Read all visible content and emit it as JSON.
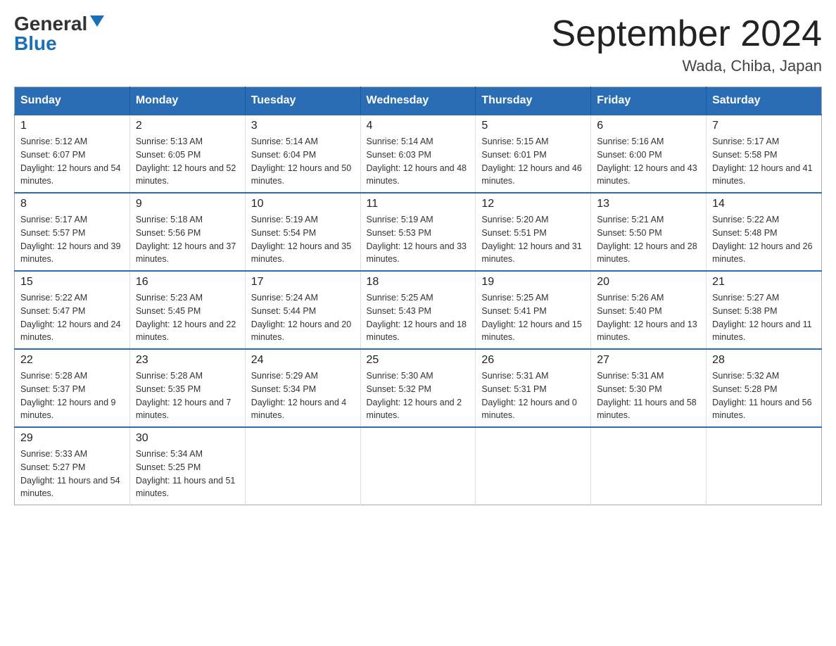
{
  "logo": {
    "general": "General",
    "blue": "Blue"
  },
  "header": {
    "title": "September 2024",
    "location": "Wada, Chiba, Japan"
  },
  "calendar": {
    "days_of_week": [
      "Sunday",
      "Monday",
      "Tuesday",
      "Wednesday",
      "Thursday",
      "Friday",
      "Saturday"
    ],
    "weeks": [
      [
        {
          "day": "1",
          "sunrise": "5:12 AM",
          "sunset": "6:07 PM",
          "daylight": "12 hours and 54 minutes."
        },
        {
          "day": "2",
          "sunrise": "5:13 AM",
          "sunset": "6:05 PM",
          "daylight": "12 hours and 52 minutes."
        },
        {
          "day": "3",
          "sunrise": "5:14 AM",
          "sunset": "6:04 PM",
          "daylight": "12 hours and 50 minutes."
        },
        {
          "day": "4",
          "sunrise": "5:14 AM",
          "sunset": "6:03 PM",
          "daylight": "12 hours and 48 minutes."
        },
        {
          "day": "5",
          "sunrise": "5:15 AM",
          "sunset": "6:01 PM",
          "daylight": "12 hours and 46 minutes."
        },
        {
          "day": "6",
          "sunrise": "5:16 AM",
          "sunset": "6:00 PM",
          "daylight": "12 hours and 43 minutes."
        },
        {
          "day": "7",
          "sunrise": "5:17 AM",
          "sunset": "5:58 PM",
          "daylight": "12 hours and 41 minutes."
        }
      ],
      [
        {
          "day": "8",
          "sunrise": "5:17 AM",
          "sunset": "5:57 PM",
          "daylight": "12 hours and 39 minutes."
        },
        {
          "day": "9",
          "sunrise": "5:18 AM",
          "sunset": "5:56 PM",
          "daylight": "12 hours and 37 minutes."
        },
        {
          "day": "10",
          "sunrise": "5:19 AM",
          "sunset": "5:54 PM",
          "daylight": "12 hours and 35 minutes."
        },
        {
          "day": "11",
          "sunrise": "5:19 AM",
          "sunset": "5:53 PM",
          "daylight": "12 hours and 33 minutes."
        },
        {
          "day": "12",
          "sunrise": "5:20 AM",
          "sunset": "5:51 PM",
          "daylight": "12 hours and 31 minutes."
        },
        {
          "day": "13",
          "sunrise": "5:21 AM",
          "sunset": "5:50 PM",
          "daylight": "12 hours and 28 minutes."
        },
        {
          "day": "14",
          "sunrise": "5:22 AM",
          "sunset": "5:48 PM",
          "daylight": "12 hours and 26 minutes."
        }
      ],
      [
        {
          "day": "15",
          "sunrise": "5:22 AM",
          "sunset": "5:47 PM",
          "daylight": "12 hours and 24 minutes."
        },
        {
          "day": "16",
          "sunrise": "5:23 AM",
          "sunset": "5:45 PM",
          "daylight": "12 hours and 22 minutes."
        },
        {
          "day": "17",
          "sunrise": "5:24 AM",
          "sunset": "5:44 PM",
          "daylight": "12 hours and 20 minutes."
        },
        {
          "day": "18",
          "sunrise": "5:25 AM",
          "sunset": "5:43 PM",
          "daylight": "12 hours and 18 minutes."
        },
        {
          "day": "19",
          "sunrise": "5:25 AM",
          "sunset": "5:41 PM",
          "daylight": "12 hours and 15 minutes."
        },
        {
          "day": "20",
          "sunrise": "5:26 AM",
          "sunset": "5:40 PM",
          "daylight": "12 hours and 13 minutes."
        },
        {
          "day": "21",
          "sunrise": "5:27 AM",
          "sunset": "5:38 PM",
          "daylight": "12 hours and 11 minutes."
        }
      ],
      [
        {
          "day": "22",
          "sunrise": "5:28 AM",
          "sunset": "5:37 PM",
          "daylight": "12 hours and 9 minutes."
        },
        {
          "day": "23",
          "sunrise": "5:28 AM",
          "sunset": "5:35 PM",
          "daylight": "12 hours and 7 minutes."
        },
        {
          "day": "24",
          "sunrise": "5:29 AM",
          "sunset": "5:34 PM",
          "daylight": "12 hours and 4 minutes."
        },
        {
          "day": "25",
          "sunrise": "5:30 AM",
          "sunset": "5:32 PM",
          "daylight": "12 hours and 2 minutes."
        },
        {
          "day": "26",
          "sunrise": "5:31 AM",
          "sunset": "5:31 PM",
          "daylight": "12 hours and 0 minutes."
        },
        {
          "day": "27",
          "sunrise": "5:31 AM",
          "sunset": "5:30 PM",
          "daylight": "11 hours and 58 minutes."
        },
        {
          "day": "28",
          "sunrise": "5:32 AM",
          "sunset": "5:28 PM",
          "daylight": "11 hours and 56 minutes."
        }
      ],
      [
        {
          "day": "29",
          "sunrise": "5:33 AM",
          "sunset": "5:27 PM",
          "daylight": "11 hours and 54 minutes."
        },
        {
          "day": "30",
          "sunrise": "5:34 AM",
          "sunset": "5:25 PM",
          "daylight": "11 hours and 51 minutes."
        },
        null,
        null,
        null,
        null,
        null
      ]
    ],
    "labels": {
      "sunrise": "Sunrise:",
      "sunset": "Sunset:",
      "daylight": "Daylight:"
    }
  }
}
